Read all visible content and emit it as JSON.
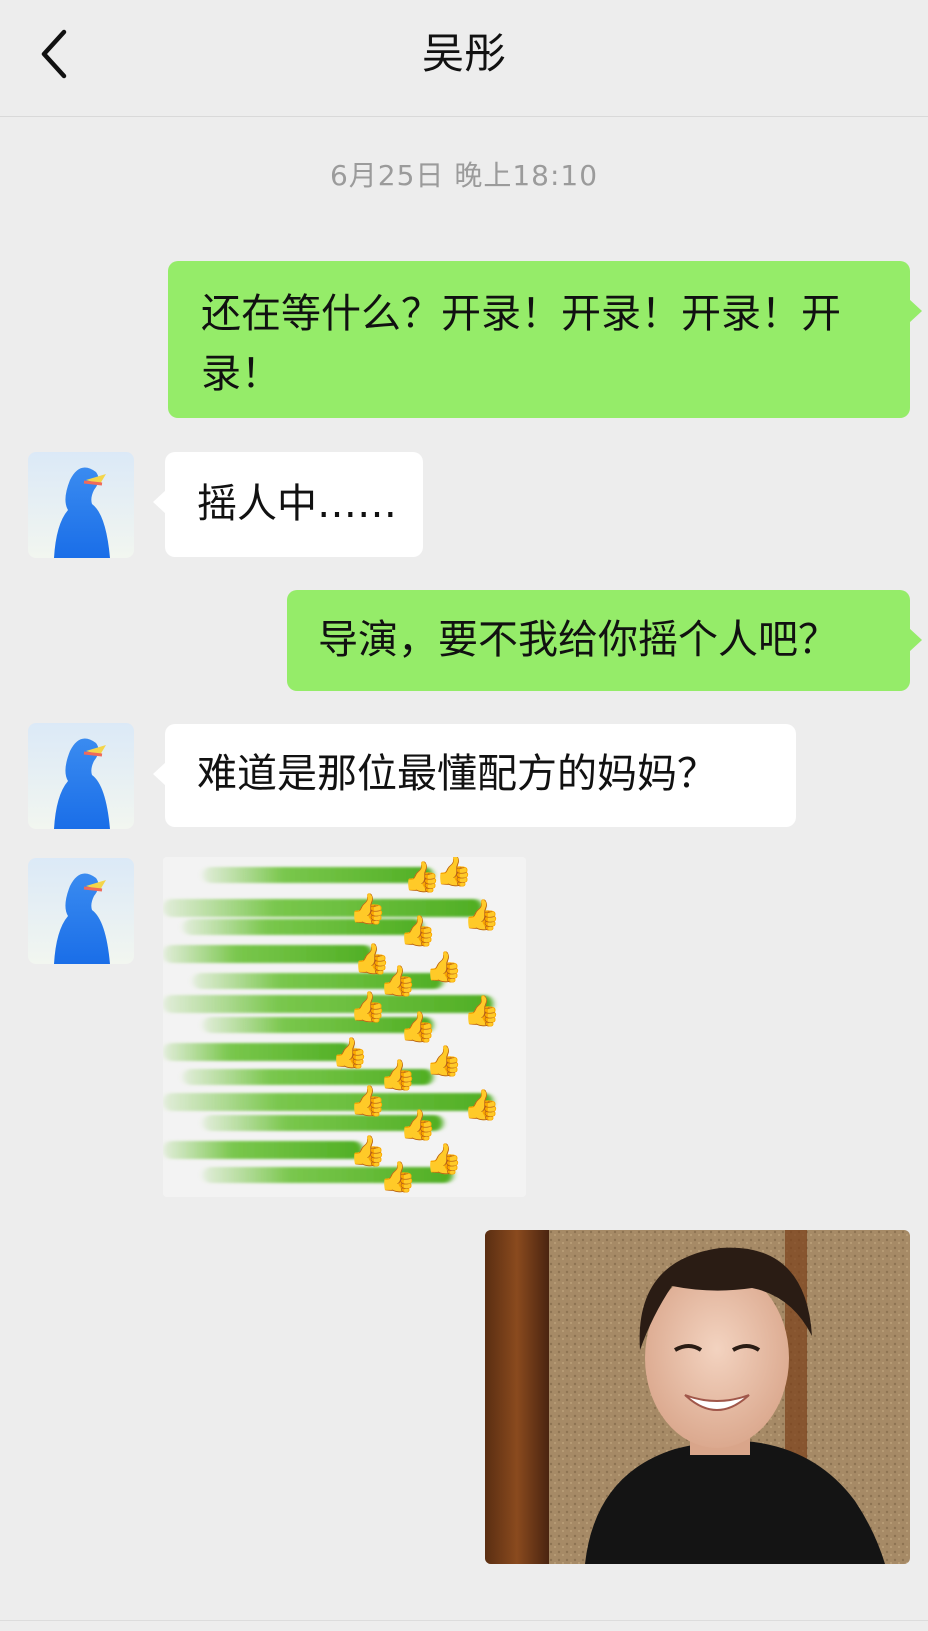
{
  "header": {
    "title": "吴彤",
    "back_icon": "chevron-left-icon"
  },
  "chat": {
    "timestamp": "6月25日 晚上18:10",
    "messages": [
      {
        "from": "me",
        "text": "还在等什么？开录！开录！开录！开录！"
      },
      {
        "from": "other",
        "text": "摇人中……"
      },
      {
        "from": "me",
        "text": "导演，要不我给你摇个人吧？"
      },
      {
        "from": "other",
        "text": "难道是那位最懂配方的妈妈？"
      },
      {
        "from": "other",
        "type": "sticker",
        "content": "green-thumbs-up-sticker"
      },
      {
        "from": "me",
        "type": "image",
        "content": "smiling-person-photo"
      }
    ]
  },
  "colors": {
    "background": "#ededed",
    "sent_bubble": "#95ec69",
    "received_bubble": "#ffffff",
    "timestamp_text": "#9b9b9b"
  }
}
